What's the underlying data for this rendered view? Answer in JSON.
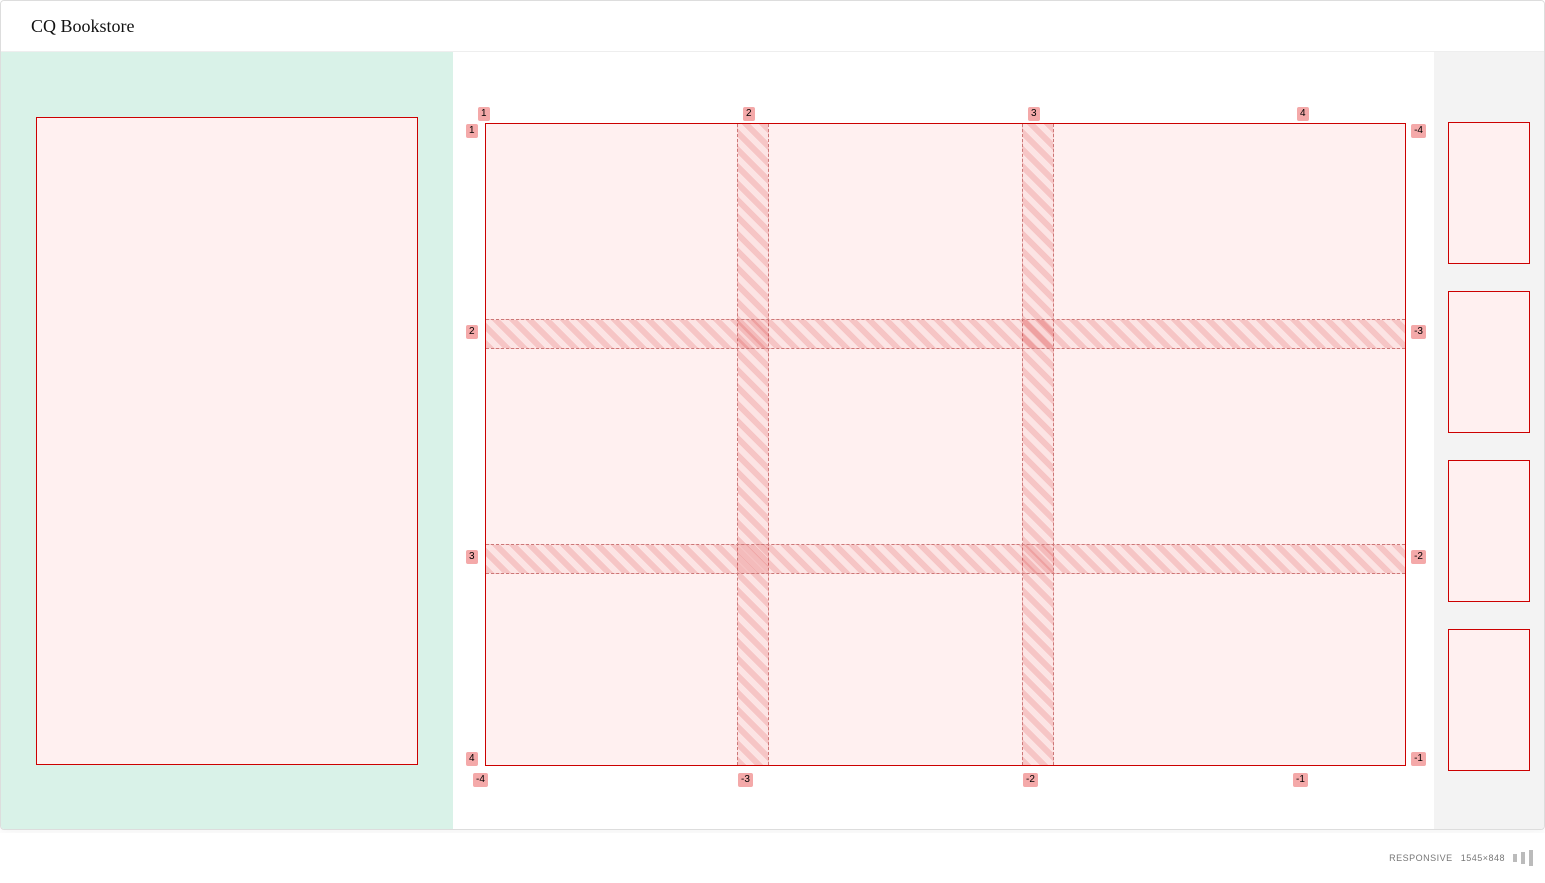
{
  "header": {
    "title": "CQ Bookstore"
  },
  "grid_overlay": {
    "columns": {
      "top": [
        "1",
        "2",
        "3",
        "4"
      ],
      "bottom": [
        "-4",
        "-3",
        "-2",
        "-1"
      ]
    },
    "rows": {
      "left": [
        "1",
        "2",
        "3",
        "4"
      ],
      "right": [
        "-4",
        "-3",
        "-2",
        "-1"
      ]
    }
  },
  "status": {
    "responsive": "responsive",
    "size": "1545×848"
  },
  "right_items": [
    {},
    {},
    {},
    {}
  ]
}
